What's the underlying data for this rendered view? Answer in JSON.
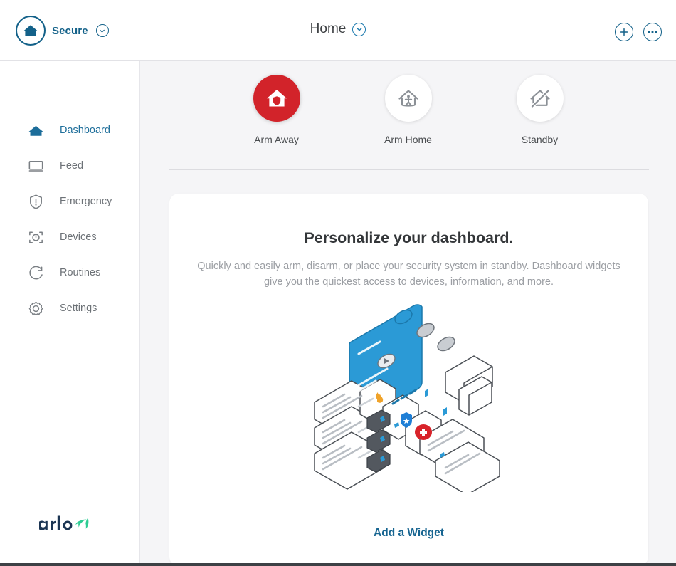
{
  "header": {
    "brand_label": "Secure",
    "brand_icon": "home-shield-icon",
    "brand_chevron_icon": "chevron-down-icon",
    "title": "Home",
    "title_chevron_icon": "chevron-down-icon",
    "add_icon": "plus-circle-icon",
    "more_icon": "more-horizontal-icon"
  },
  "sidebar": {
    "items": [
      {
        "label": "Dashboard",
        "icon": "home-icon",
        "active": true
      },
      {
        "label": "Feed",
        "icon": "monitor-icon",
        "active": false
      },
      {
        "label": "Emergency",
        "icon": "shield-alert-icon",
        "active": false
      },
      {
        "label": "Devices",
        "icon": "camera-focus-icon",
        "active": false
      },
      {
        "label": "Routines",
        "icon": "refresh-circle-icon",
        "active": false
      },
      {
        "label": "Settings",
        "icon": "gear-icon",
        "active": false
      }
    ],
    "logo_text": "arlo"
  },
  "modes": [
    {
      "label": "Arm Away",
      "icon": "house-shield-icon",
      "active": true
    },
    {
      "label": "Arm Home",
      "icon": "house-person-icon",
      "active": false
    },
    {
      "label": "Standby",
      "icon": "house-slash-icon",
      "active": false
    }
  ],
  "panel": {
    "title": "Personalize your dashboard.",
    "subtitle": "Quickly and easily arm, disarm, or place your security system in standby. Dashboard widgets give you the quickest access to devices, information, and more.",
    "illustration": "dashboard-widgets-illustration",
    "add_widget_label": "Add a Widget"
  },
  "colors": {
    "accent_blue": "#136189",
    "link_blue": "#176591",
    "active_red": "#d2232a",
    "page_bg": "#f5f5f7",
    "text_gray": "#6d7277",
    "illo_blue": "#2b9ad6",
    "logo_navy": "#1c3553",
    "logo_green": "#2ecc93"
  }
}
